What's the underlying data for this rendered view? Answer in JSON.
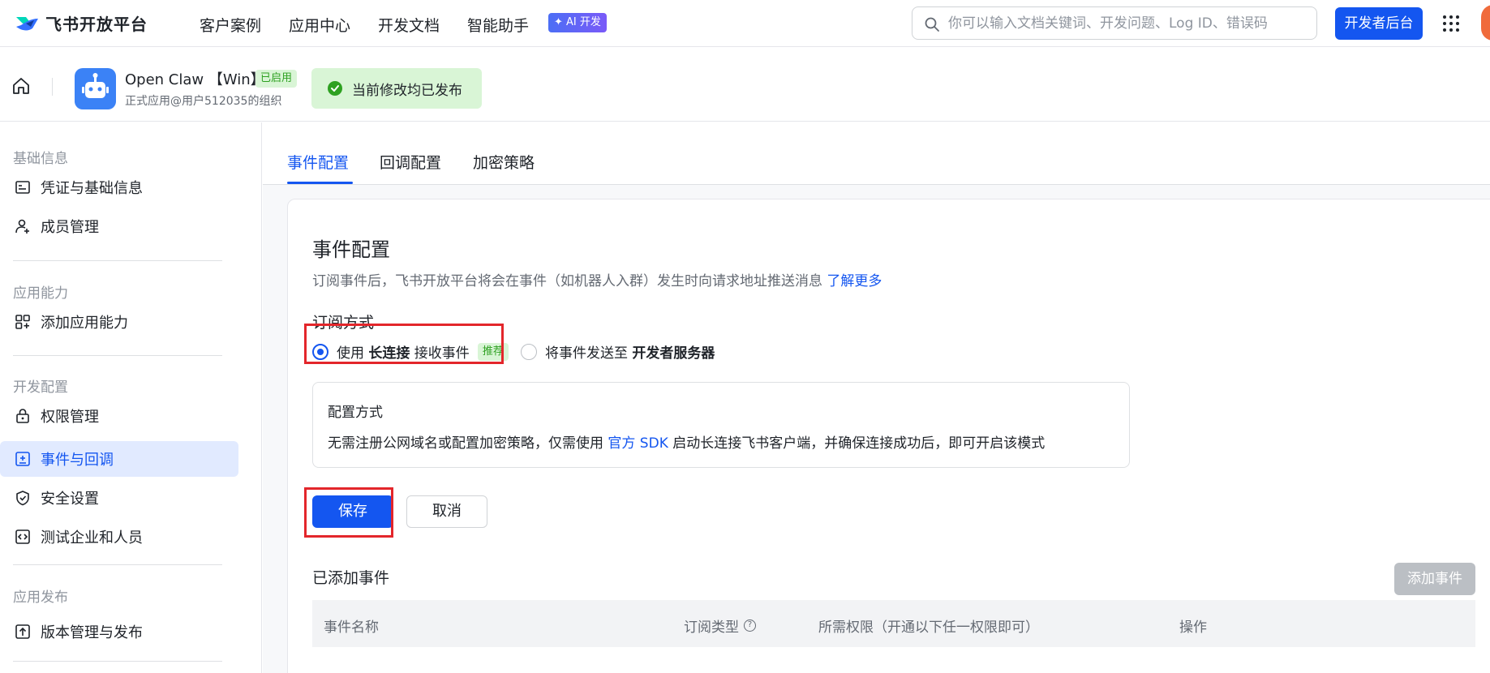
{
  "topnav": {
    "brand": "飞书开放平台",
    "links": [
      "客户案例",
      "应用中心",
      "开发文档",
      "智能助手"
    ],
    "ai_badge": "✦ AI 开发",
    "search_placeholder": "你可以输入文档关键词、开发问题、Log ID、错误码",
    "dev_console": "开发者后台"
  },
  "app": {
    "name": "Open Claw 【Win】",
    "status_badge": "已启用",
    "org": "正式应用@用户512035的组织",
    "publish_tip": "当前修改均已发布"
  },
  "sidebar": {
    "sections": [
      {
        "title": "基础信息",
        "items": [
          {
            "label": "凭证与基础信息",
            "icon": "credential-icon"
          },
          {
            "label": "成员管理",
            "icon": "user-add-icon"
          }
        ]
      },
      {
        "title": "应用能力",
        "items": [
          {
            "label": "添加应用能力",
            "icon": "apps-plus-icon"
          }
        ]
      },
      {
        "title": "开发配置",
        "items": [
          {
            "label": "权限管理",
            "icon": "lock-icon"
          },
          {
            "label": "事件与回调",
            "icon": "event-icon"
          },
          {
            "label": "安全设置",
            "icon": "shield-icon"
          },
          {
            "label": "测试企业和人员",
            "icon": "code-icon"
          }
        ]
      },
      {
        "title": "应用发布",
        "items": [
          {
            "label": "版本管理与发布",
            "icon": "upload-icon"
          }
        ]
      }
    ]
  },
  "tabs": [
    "事件配置",
    "回调配置",
    "加密策略"
  ],
  "event_config": {
    "title": "事件配置",
    "description": "订阅事件后，飞书开放平台将会在事件（如机器人入群）发生时向请求地址推送消息",
    "learn_more": "了解更多",
    "subscribe_label": "订阅方式",
    "option1_prefix": "使用 ",
    "option1_bold": "长连接",
    "option1_suffix": " 接收事件",
    "option1_badge": "推荐",
    "option2_prefix": "将事件发送至 ",
    "option2_bold": "开发者服务器",
    "config_title": "配置方式",
    "config_text_1": "无需注册公网域名或配置加密策略，仅需使用 ",
    "config_link": "官方 SDK",
    "config_text_2": " 启动长连接飞书客户端，并确保连接成功后，即可开启该模式",
    "save": "保存",
    "cancel": "取消",
    "added_events": "已添加事件",
    "add_event": "添加事件",
    "table_headers": [
      "事件名称",
      "订阅类型",
      "所需权限（开通以下任一权限即可）",
      "操作"
    ]
  }
}
